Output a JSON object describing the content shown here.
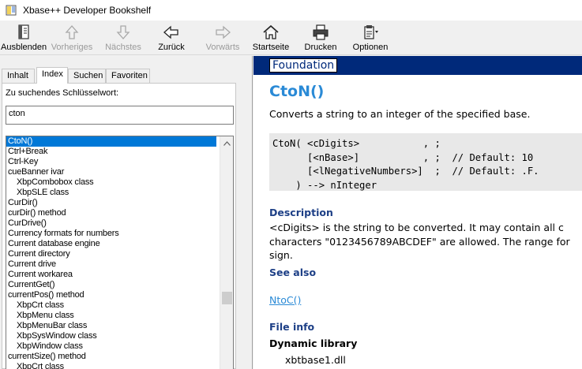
{
  "window": {
    "title": "Xbase++ Developer Bookshelf"
  },
  "toolbar": {
    "buttons": [
      {
        "label": "Ausblenden",
        "icon": "hide-pane-icon",
        "enabled": true
      },
      {
        "label": "Vorheriges",
        "icon": "arrow-up-icon",
        "enabled": false
      },
      {
        "label": "Nächstes",
        "icon": "arrow-down-icon",
        "enabled": false
      },
      {
        "label": "Zurück",
        "icon": "arrow-left-icon",
        "enabled": true
      },
      {
        "label": "Vorwärts",
        "icon": "arrow-right-icon",
        "enabled": false
      },
      {
        "label": "Startseite",
        "icon": "home-icon",
        "enabled": true
      },
      {
        "label": "Drucken",
        "icon": "printer-icon",
        "enabled": true
      },
      {
        "label": "Optionen",
        "icon": "options-icon",
        "enabled": true
      }
    ]
  },
  "tabs": [
    {
      "label": "Inhalt",
      "active": false
    },
    {
      "label": "Index",
      "active": true
    },
    {
      "label": "Suchen",
      "active": false
    },
    {
      "label": "Favoriten",
      "active": false
    }
  ],
  "index": {
    "keyword_label": "Zu suchendes Schlüsselwort:",
    "keyword_value": "cton",
    "items": [
      {
        "label": "CtoN()",
        "indent": false,
        "selected": true
      },
      {
        "label": "Ctrl+Break",
        "indent": false
      },
      {
        "label": "Ctrl-Key",
        "indent": false
      },
      {
        "label": "cueBanner ivar",
        "indent": false
      },
      {
        "label": "XbpCombobox class",
        "indent": true
      },
      {
        "label": "XbpSLE class",
        "indent": true
      },
      {
        "label": "CurDir()",
        "indent": false
      },
      {
        "label": "curDir() method",
        "indent": false
      },
      {
        "label": "CurDrive()",
        "indent": false
      },
      {
        "label": "Currency formats for numbers",
        "indent": false
      },
      {
        "label": "Current database engine",
        "indent": false
      },
      {
        "label": "Current directory",
        "indent": false
      },
      {
        "label": "Current drive",
        "indent": false
      },
      {
        "label": "Current workarea",
        "indent": false
      },
      {
        "label": "CurrentGet()",
        "indent": false
      },
      {
        "label": "currentPos() method",
        "indent": false
      },
      {
        "label": "XbpCrt class",
        "indent": true
      },
      {
        "label": "XbpMenu class",
        "indent": true
      },
      {
        "label": "XbpMenuBar class",
        "indent": true
      },
      {
        "label": "XbpSysWindow class",
        "indent": true
      },
      {
        "label": "XbpWindow class",
        "indent": true
      },
      {
        "label": "currentSize() method",
        "indent": false
      },
      {
        "label": "XbpCrt class",
        "indent": true
      }
    ]
  },
  "content": {
    "banner": "Foundation",
    "title": "CtoN()",
    "summary": "Converts a string to an integer of the specified base.",
    "syntax_lines": [
      "CtoN( <cDigits>           , ;",
      "      [<nBase>]           , ;  // Default: 10",
      "      [<lNegativeNumbers>]  ;  // Default: .F.",
      "    ) --> nInteger"
    ],
    "description_heading": "Description",
    "description_lines": [
      "<cDigits> is the string to be converted. It may contain all c",
      "characters \"0123456789ABCDEF\" are allowed. The range for",
      "sign."
    ],
    "see_also_heading": "See also",
    "see_also_link": "NtoC()",
    "file_info_heading": "File info",
    "dynamic_library_heading": "Dynamic library",
    "dynamic_library": "xbtbase1.dll"
  },
  "colors": {
    "banner_bg": "#00297a",
    "title": "#2a8ad6",
    "heading": "#1d3f86",
    "selection": "#0078d7"
  }
}
